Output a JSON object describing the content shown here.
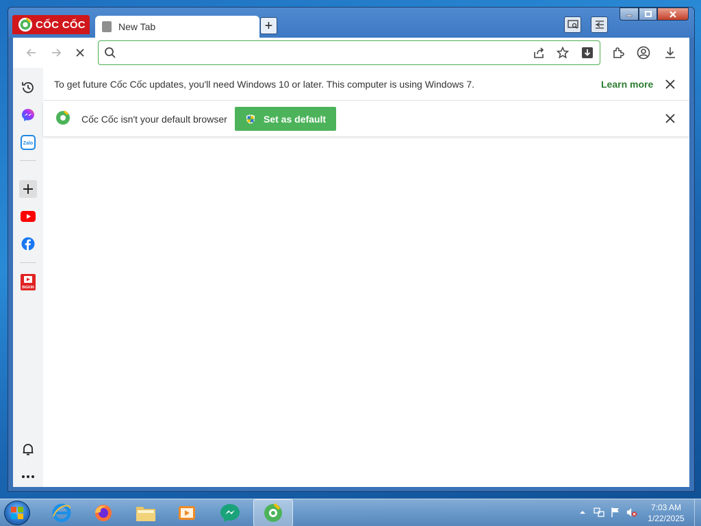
{
  "browser": {
    "logo_text": "CỐC CỐC",
    "tab": {
      "title": "New Tab"
    },
    "omnibox": {
      "value": "",
      "placeholder": ""
    }
  },
  "infobars": {
    "os_warning": {
      "text": "To get future Cốc Cốc updates, you'll need Windows 10 or later. This computer is using Windows 7.",
      "link": "Learn more"
    },
    "default_browser": {
      "text": "Cốc Cốc isn't your default browser",
      "button": "Set as default"
    }
  },
  "sidebar": {
    "items": [
      "history-icon",
      "messenger-icon",
      "zalo-icon",
      "add-icon",
      "youtube-icon",
      "facebook-icon",
      "tv-app-icon",
      "bell-icon",
      "more-icon"
    ],
    "zalo_label": "Zalo",
    "tv_label": "BIGKIN"
  },
  "taskbar": {
    "apps": [
      "internet-explorer-icon",
      "firefox-icon",
      "file-explorer-icon",
      "media-player-icon",
      "messenger-app-icon",
      "coccoc-icon"
    ],
    "clock": {
      "time": "7:03 AM",
      "date": "1/22/2025"
    }
  },
  "colors": {
    "accent_green": "#4cb35a",
    "link_green": "#2e7d32",
    "brand_red": "#d0171b"
  }
}
